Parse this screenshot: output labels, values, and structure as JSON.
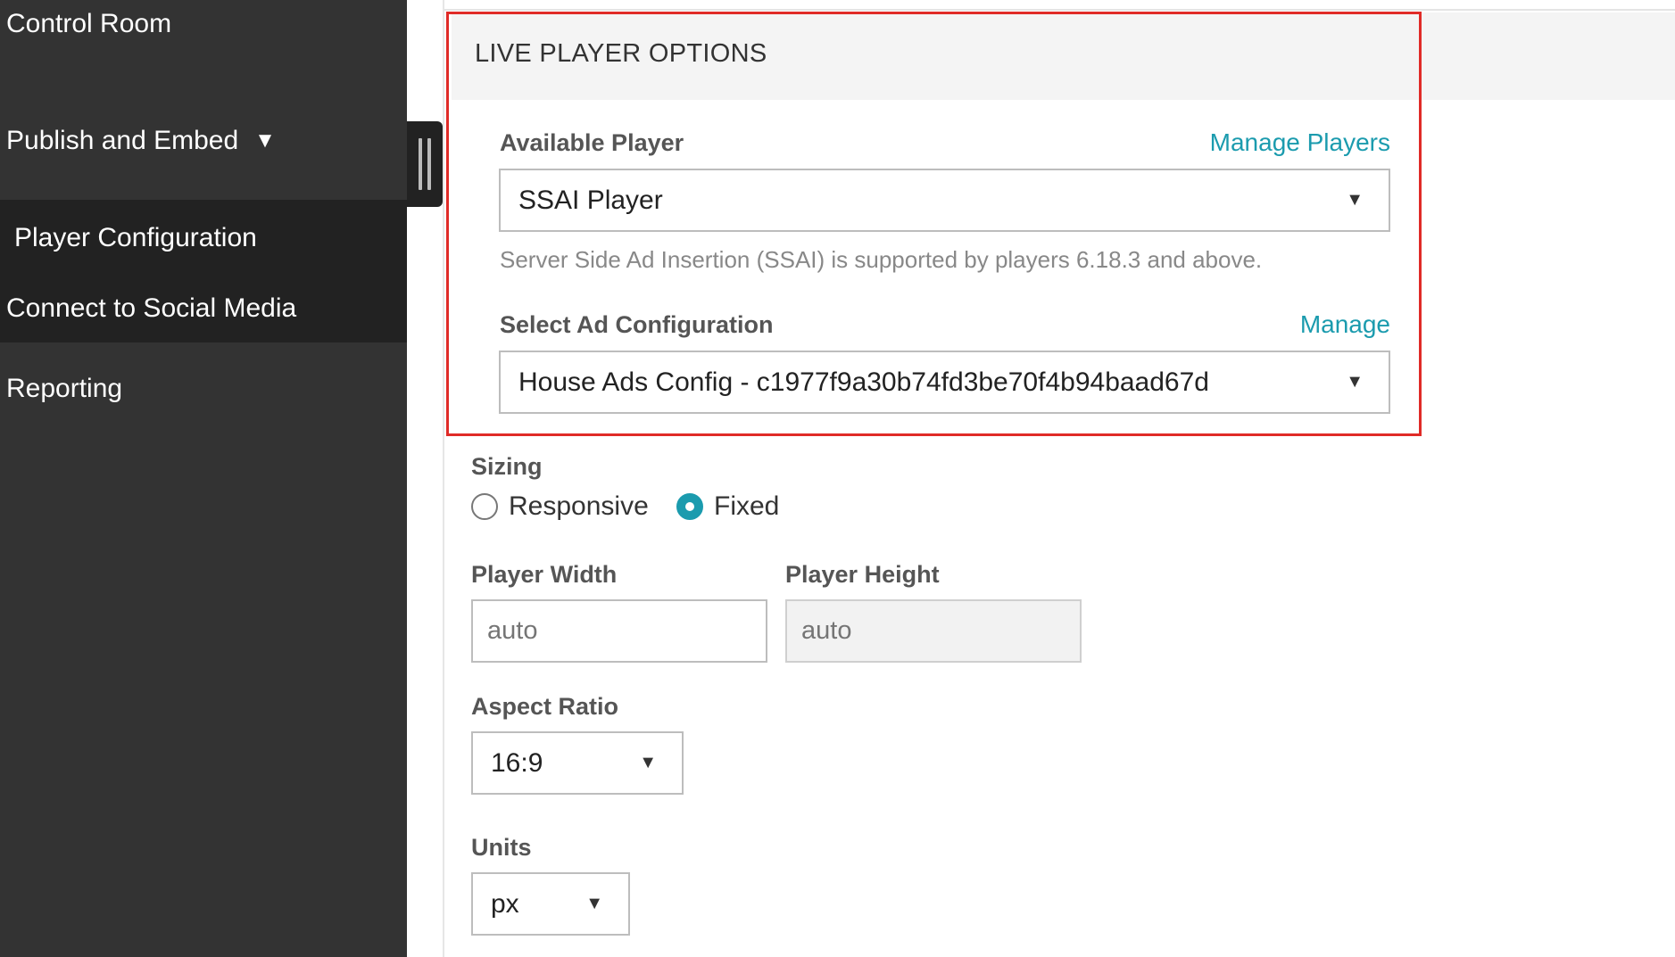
{
  "sidebar": {
    "control_room": "Control Room",
    "publish_and_embed": "Publish and Embed",
    "publish_caret": "▼",
    "player_configuration": "Player Configuration",
    "connect_social": "Connect to Social Media",
    "reporting": "Reporting"
  },
  "section": {
    "title": "LIVE PLAYER OPTIONS"
  },
  "available_player": {
    "label": "Available Player",
    "manage_link": "Manage Players",
    "selected": "SSAI Player",
    "arrow": "▼",
    "help": "Server Side Ad Insertion (SSAI) is supported by players 6.18.3 and above."
  },
  "ad_config": {
    "label": "Select Ad Configuration",
    "manage_link": "Manage",
    "selected": "House Ads Config - c1977f9a30b74fd3be70f4b94baad67d",
    "arrow": "▼"
  },
  "sizing": {
    "label": "Sizing",
    "options": [
      "Responsive",
      "Fixed"
    ],
    "selected": "Fixed"
  },
  "player_width": {
    "label": "Player Width",
    "value": "auto"
  },
  "player_height": {
    "label": "Player Height",
    "value": "auto"
  },
  "aspect_ratio": {
    "label": "Aspect Ratio",
    "selected": "16:9",
    "arrow": "▼"
  },
  "units": {
    "label": "Units",
    "selected": "px",
    "arrow": "▼"
  },
  "colors": {
    "sidebar_bg": "#333333",
    "sidebar_sub_bg": "#222222",
    "accent": "#1b9bae",
    "highlight": "#e02b27"
  }
}
